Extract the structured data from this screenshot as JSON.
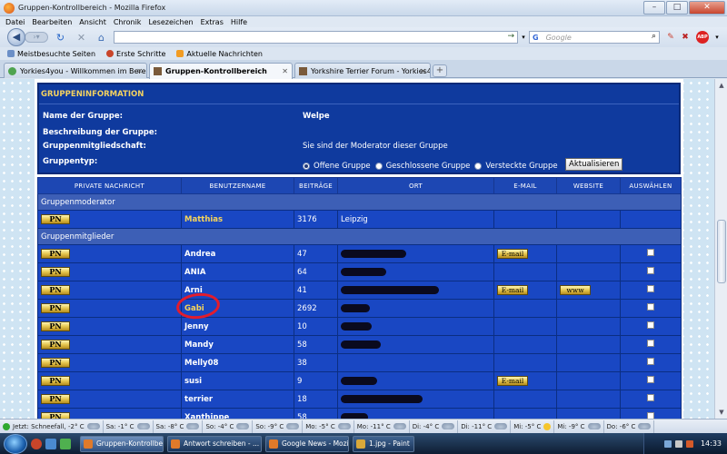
{
  "window": {
    "title": "Gruppen-Kontrollbereich - Mozilla Firefox"
  },
  "menu": [
    "Datei",
    "Bearbeiten",
    "Ansicht",
    "Chronik",
    "Lesezeichen",
    "Extras",
    "Hilfe"
  ],
  "search": {
    "engine": "G",
    "placeholder": "Google"
  },
  "bookmarks": [
    "Meistbesuchte Seiten",
    "Erste Schritte",
    "Aktuelle Nachrichten"
  ],
  "tabs": [
    {
      "label": "Yorkies4you - Willkommen im Berei...",
      "active": false
    },
    {
      "label": "Gruppen-Kontrollbereich",
      "active": true
    },
    {
      "label": "Yorkshire Terrier Forum - Yorkies4y...",
      "active": false
    }
  ],
  "info": {
    "header": "GRUPPENINFORMATION",
    "name_label": "Name der Gruppe:",
    "name_value": "Welpe",
    "desc_label": "Beschreibung der Gruppe:",
    "membership_label": "Gruppenmitgliedschaft:",
    "membership_value": "Sie sind der Moderator dieser Gruppe",
    "type_label": "Gruppentyp:",
    "type_open": "Offene Gruppe",
    "type_closed": "Geschlossene Gruppe",
    "type_hidden": "Versteckte Gruppe",
    "update_button": "Aktualisieren"
  },
  "table": {
    "headers": [
      "PRIVATE NACHRICHT",
      "BENUTZERNAME",
      "BEITRÄGE",
      "ORT",
      "E-MAIL",
      "WEBSITE",
      "AUSWÄHLEN"
    ],
    "moderator_section": "Gruppenmoderator",
    "members_section": "Gruppenmitglieder",
    "pn_label": "PN",
    "email_label": "E-mail",
    "www_label": "www",
    "moderator": {
      "name": "Matthias",
      "posts": "3176",
      "location": "Leipzig"
    },
    "members": [
      {
        "name": "Andrea",
        "posts": "47",
        "email": true,
        "www": false
      },
      {
        "name": "ANIA",
        "posts": "64",
        "email": false,
        "www": false
      },
      {
        "name": "Arni",
        "posts": "41",
        "email": true,
        "www": true
      },
      {
        "name": "Gabi",
        "posts": "2692",
        "email": false,
        "www": false,
        "highlight": true
      },
      {
        "name": "Jenny",
        "posts": "10",
        "email": false,
        "www": false
      },
      {
        "name": "Mandy",
        "posts": "58",
        "email": false,
        "www": false
      },
      {
        "name": "Melly08",
        "posts": "38",
        "email": false,
        "www": false
      },
      {
        "name": "susi",
        "posts": "9",
        "email": true,
        "www": false
      },
      {
        "name": "terrier",
        "posts": "18",
        "email": false,
        "www": false
      },
      {
        "name": "Xanthippe",
        "posts": "58",
        "email": false,
        "www": false
      }
    ]
  },
  "weather": [
    "Jetzt: Schneefall, -2° C",
    "Sa: -1° C",
    "Sa: -8° C",
    "So: -4° C",
    "So: -9° C",
    "Mo: -5° C",
    "Mo: -11° C",
    "Di: -4° C",
    "Di: -11° C",
    "Mi: -5° C",
    "Mi: -9° C",
    "Do: -6° C"
  ],
  "taskbar": {
    "tasks": [
      "Gruppen-Kontrollbe...",
      "Antwort schreiben - ...",
      "Google News - Mozi...",
      "1.jpg - Paint"
    ],
    "clock": "14:33"
  },
  "colors": {
    "panel_blue": "#0f3a9e",
    "row_blue": "#1947c3",
    "heading_gold": "#f4d260",
    "annotation_red": "#e31c2c"
  }
}
